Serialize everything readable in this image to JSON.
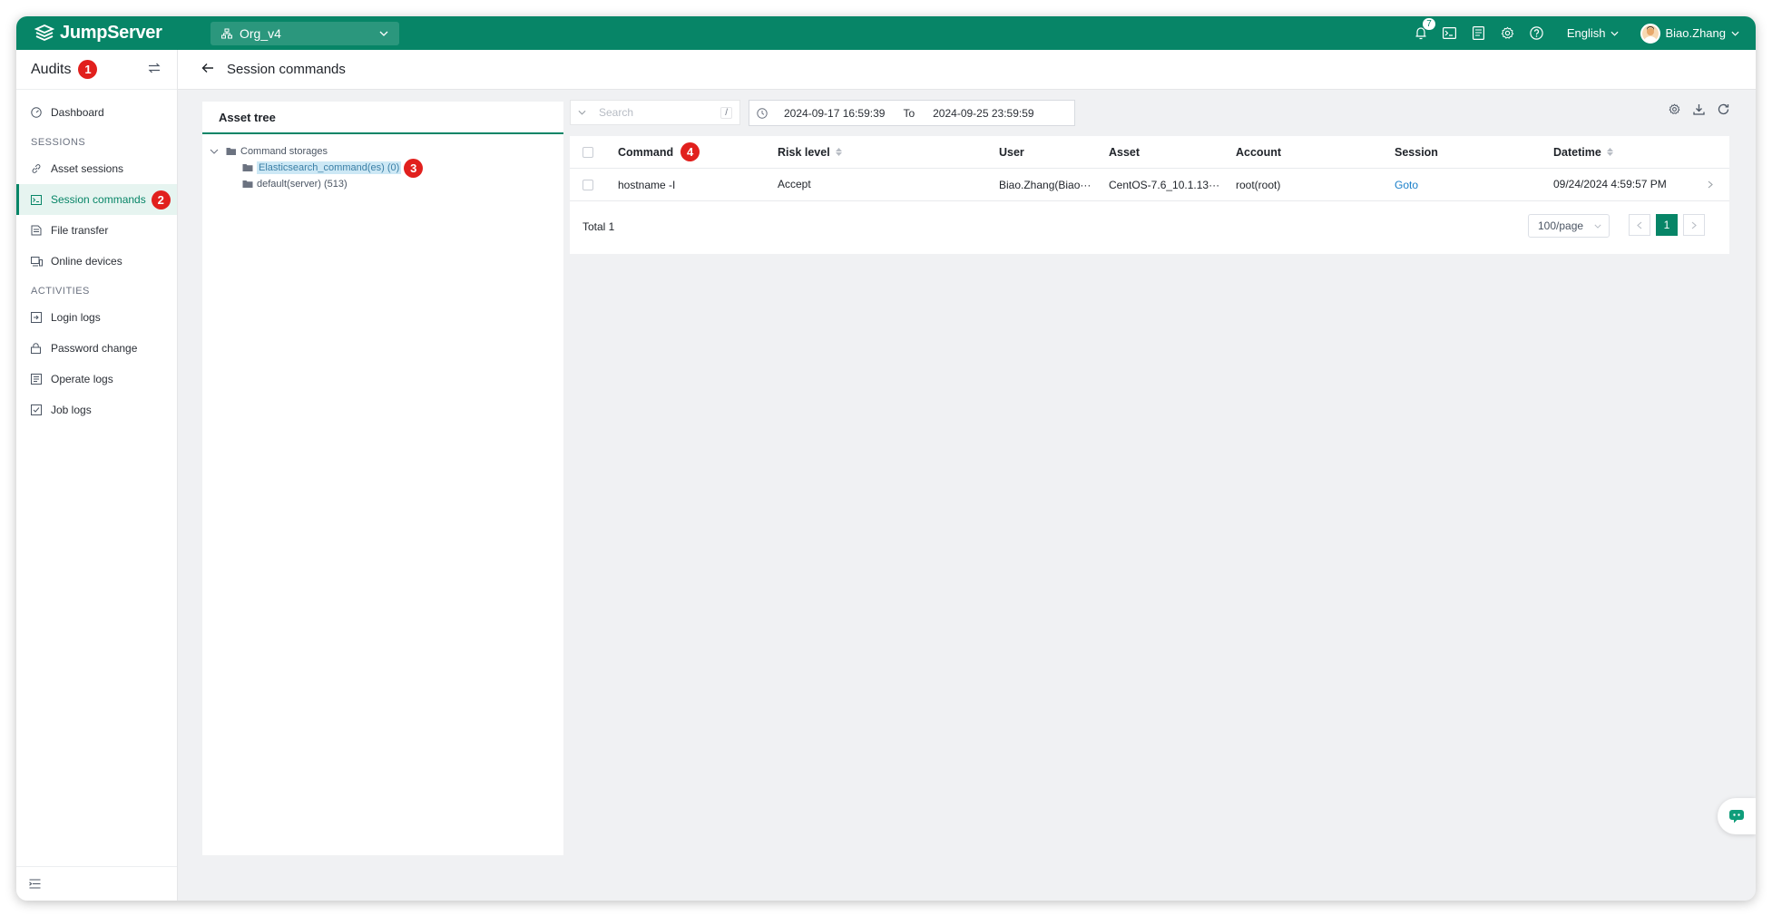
{
  "header": {
    "brand": "JumpServer",
    "org": "Org_v4",
    "notification_count": "7",
    "language": "English",
    "username": "Biao.Zhang",
    "accent_color": "#078567"
  },
  "sidebar": {
    "title": "Audits",
    "title_marker": "1",
    "items_top": [
      {
        "label": "Dashboard",
        "icon": "dashboard-icon"
      }
    ],
    "section_sessions": "SESSIONS",
    "sessions_items": [
      {
        "label": "Asset sessions",
        "icon": "link-icon"
      },
      {
        "label": "Session commands",
        "icon": "terminal-icon",
        "active": true,
        "marker": "2"
      },
      {
        "label": "File transfer",
        "icon": "file-transfer-icon"
      },
      {
        "label": "Online devices",
        "icon": "devices-icon"
      }
    ],
    "section_activities": "ACTIVITIES",
    "activities_items": [
      {
        "label": "Login logs",
        "icon": "login-icon"
      },
      {
        "label": "Password change",
        "icon": "lock-icon"
      },
      {
        "label": "Operate logs",
        "icon": "list-icon"
      },
      {
        "label": "Job logs",
        "icon": "checklist-icon"
      }
    ]
  },
  "page": {
    "title": "Session commands"
  },
  "tree": {
    "title": "Asset tree",
    "root": "Command storages",
    "nodes": [
      {
        "label": "Elasticsearch_command(es) (0)",
        "selected": true,
        "marker": "3"
      },
      {
        "label": "default(server) (513)"
      }
    ]
  },
  "toolbar": {
    "search_placeholder": "Search",
    "search_shortcut": "/",
    "date_from": "2024-09-17 16:59:39",
    "date_to_label": "To",
    "date_to": "2024-09-25 23:59:59"
  },
  "table": {
    "columns": {
      "command": "Command",
      "command_marker": "4",
      "risk": "Risk level",
      "user": "User",
      "asset": "Asset",
      "account": "Account",
      "session": "Session",
      "datetime": "Datetime"
    },
    "rows": [
      {
        "command": "hostname -I",
        "risk": "Accept",
        "user": "Biao.Zhang(Biao···",
        "asset": "CentOS-7.6_10.1.13···",
        "account": "root(root)",
        "session": "Goto",
        "datetime": "09/24/2024 4:59:57 PM"
      }
    ],
    "total": "Total 1",
    "page_size": "100/page",
    "current_page": "1"
  }
}
